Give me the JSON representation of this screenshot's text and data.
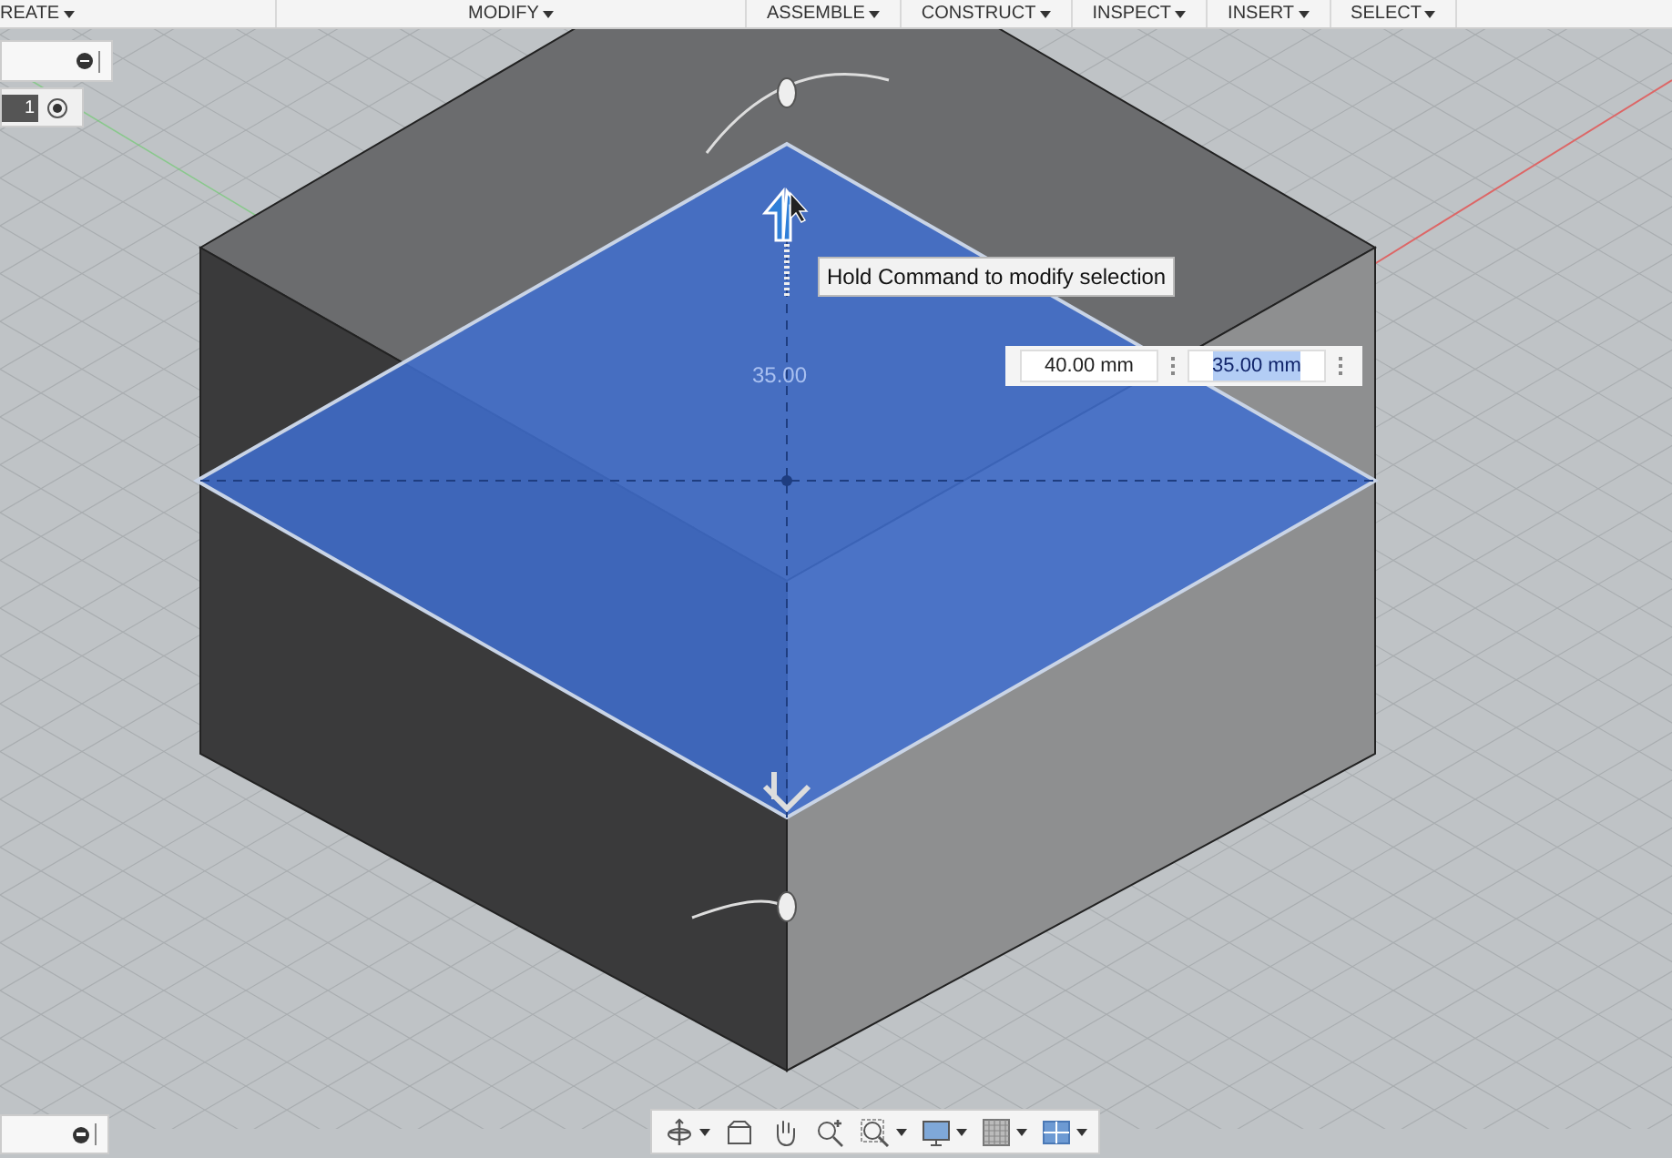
{
  "menu_bar": {
    "items": [
      {
        "label": "REATE"
      },
      {
        "label": "MODIFY"
      },
      {
        "label": "ASSEMBLE"
      },
      {
        "label": "CONSTRUCT"
      },
      {
        "label": "INSPECT"
      },
      {
        "label": "INSERT"
      },
      {
        "label": "SELECT"
      }
    ]
  },
  "left_panels": {
    "field_text": "1"
  },
  "viewport": {
    "ghost_dimension": "35.00",
    "tooltip": "Hold Command to modify selection",
    "dimension_inputs": [
      {
        "value": "40.00 mm",
        "selected": false
      },
      {
        "value": "35.00 mm",
        "selected": true
      }
    ]
  },
  "navigation_bar": {
    "tools": [
      {
        "kind": "orbit",
        "has_menu": true
      },
      {
        "kind": "look",
        "has_menu": false
      },
      {
        "kind": "pan",
        "has_menu": false
      },
      {
        "kind": "zoom",
        "has_menu": false
      },
      {
        "kind": "fit",
        "has_menu": true
      },
      {
        "kind": "display",
        "has_menu": true
      },
      {
        "kind": "grid",
        "has_menu": true
      },
      {
        "kind": "viewports",
        "has_menu": true
      }
    ]
  }
}
